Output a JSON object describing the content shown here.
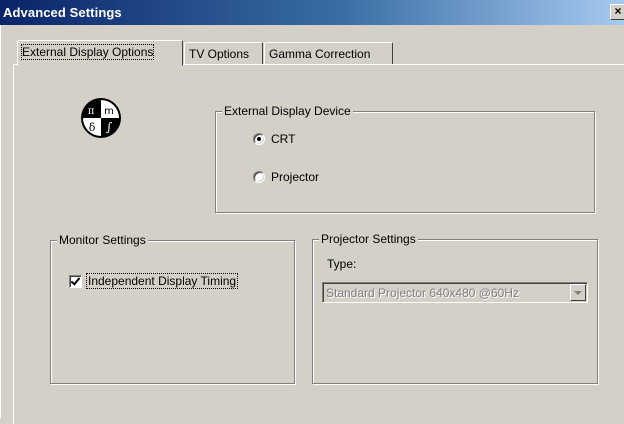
{
  "window": {
    "title": "Advanced Settings",
    "close_label": "×"
  },
  "tabs": [
    {
      "label": "External Display Options",
      "active": true
    },
    {
      "label": "TV Options",
      "active": false
    },
    {
      "label": "Gamma Correction",
      "active": false
    }
  ],
  "icon": {
    "name": "math-symbols-icon",
    "glyphs": [
      "π",
      "m",
      "δ",
      "∫"
    ]
  },
  "external_display_device": {
    "title": "External Display Device",
    "options": [
      {
        "label": "CRT",
        "checked": true
      },
      {
        "label": "Projector",
        "checked": false
      }
    ]
  },
  "monitor_settings": {
    "title": "Monitor Settings",
    "independent_timing": {
      "label": "Independent Display Timing",
      "checked": true
    }
  },
  "projector_settings": {
    "title": "Projector Settings",
    "type_label": "Type:",
    "type_value": "Standard Projector 640x480 @60Hz",
    "enabled": false
  }
}
